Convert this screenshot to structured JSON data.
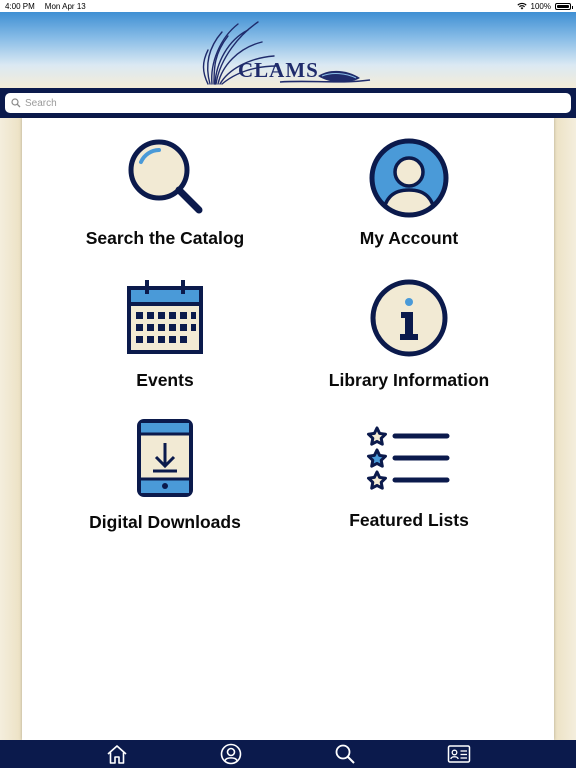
{
  "status_bar": {
    "time": "4:00 PM",
    "date": "Mon Apr 13",
    "battery": "100%"
  },
  "header": {
    "logo_text": "CLAMS"
  },
  "search": {
    "placeholder": "Search"
  },
  "tiles": [
    {
      "label": "Search the Catalog",
      "icon": "magnifier-icon"
    },
    {
      "label": "My Account",
      "icon": "user-avatar-icon"
    },
    {
      "label": "Events",
      "icon": "calendar-icon"
    },
    {
      "label": "Library Information",
      "icon": "info-icon"
    },
    {
      "label": "Digital Downloads",
      "icon": "tablet-download-icon"
    },
    {
      "label": "Featured Lists",
      "icon": "star-list-icon"
    }
  ],
  "tab_bar": [
    {
      "icon": "home-icon"
    },
    {
      "icon": "account-icon"
    },
    {
      "icon": "search-icon"
    },
    {
      "icon": "library-card-icon"
    }
  ],
  "colors": {
    "navy": "#0b1a4c",
    "blue": "#4a9ad8",
    "cream": "#f2ead4"
  }
}
